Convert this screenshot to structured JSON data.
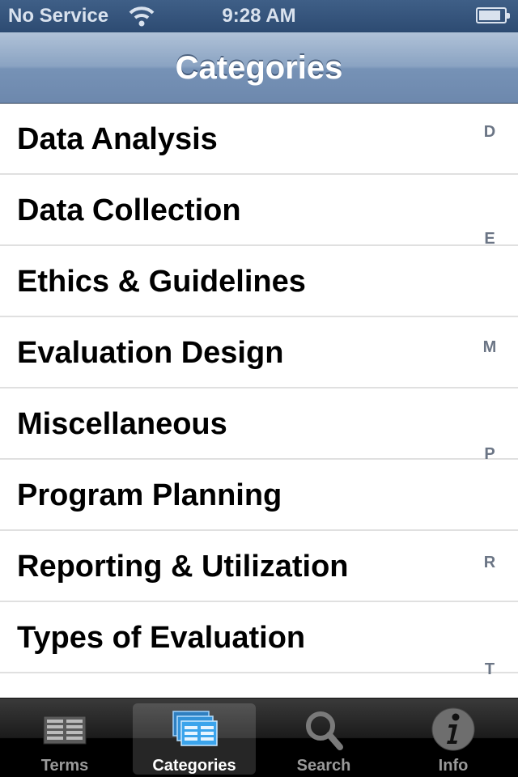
{
  "status_bar": {
    "carrier": "No Service",
    "time": "9:28 AM",
    "wifi_icon": "wifi-icon",
    "battery_icon": "battery-icon",
    "battery_level": 0.85
  },
  "nav_bar": {
    "title": "Categories"
  },
  "categories": [
    {
      "label": "Data Analysis"
    },
    {
      "label": "Data Collection"
    },
    {
      "label": "Ethics & Guidelines"
    },
    {
      "label": "Evaluation Design"
    },
    {
      "label": "Miscellaneous"
    },
    {
      "label": "Program Planning"
    },
    {
      "label": "Reporting & Utilization"
    },
    {
      "label": "Types of Evaluation"
    }
  ],
  "index": [
    "D",
    "E",
    "M",
    "P",
    "R",
    "T"
  ],
  "tab_bar": {
    "tabs": [
      {
        "label": "Terms",
        "icon": "list-icon",
        "selected": false
      },
      {
        "label": "Categories",
        "icon": "categories-icon",
        "selected": true
      },
      {
        "label": "Search",
        "icon": "search-icon",
        "selected": false
      },
      {
        "label": "Info",
        "icon": "info-icon",
        "selected": false
      }
    ]
  },
  "colors": {
    "nav_bar": "#7692b6",
    "status_bar": "#2d4b72",
    "selected_tab_icon": "#3a9ee6"
  }
}
